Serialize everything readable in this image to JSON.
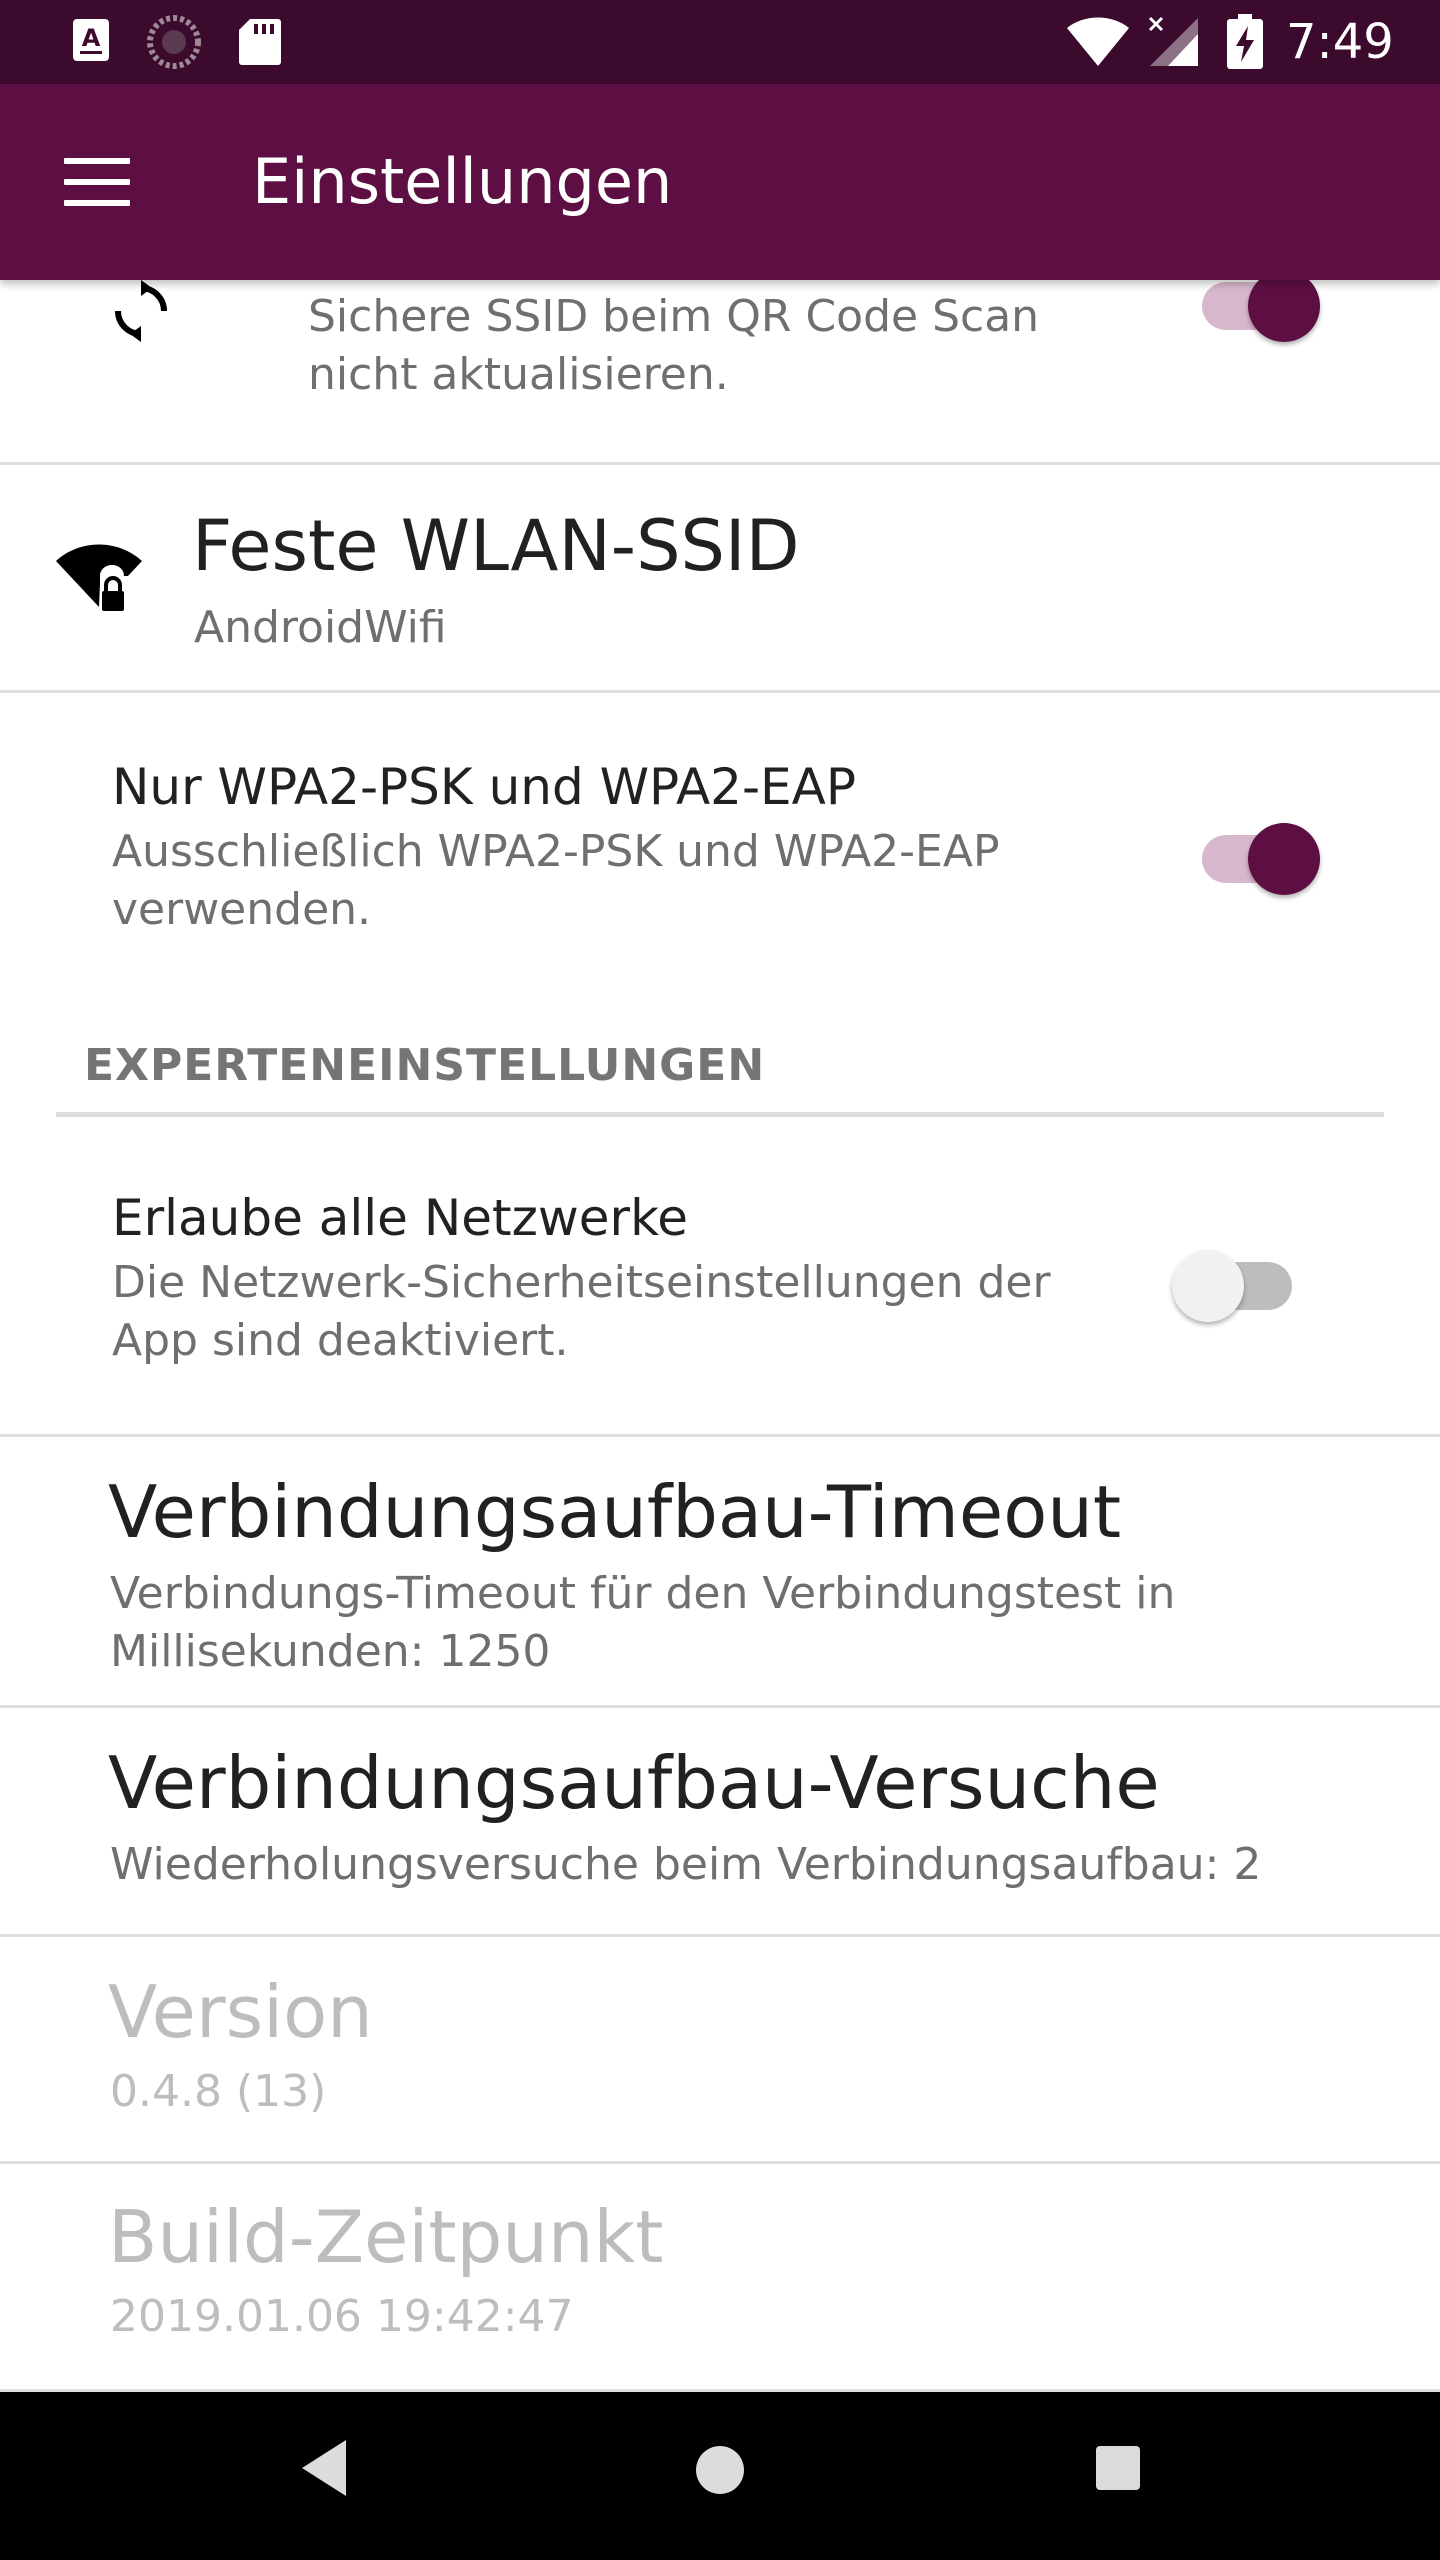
{
  "status_bar": {
    "time": "7:49",
    "icons": [
      "accessibility-a-icon",
      "sync-progress-icon",
      "sd-card-icon",
      "wifi-icon",
      "signal-no-data-icon",
      "battery-charging-icon"
    ]
  },
  "app_bar": {
    "title": "Einstellungen",
    "menu_icon": "hamburger-menu-icon"
  },
  "prefs": {
    "ssid_fixed_update": {
      "summary": "Sichere SSID beim QR Code Scan nicht aktualisieren.",
      "icon": "sync-icon",
      "enabled": true
    },
    "fixed_ssid": {
      "title": "Feste WLAN-SSID",
      "summary": "AndroidWifi",
      "icon": "wifi-lock-icon"
    },
    "wpa2_only": {
      "title": "Nur WPA2-PSK und WPA2-EAP",
      "summary": "Ausschließlich WPA2-PSK und WPA2-EAP verwenden.",
      "enabled": true
    },
    "expert_header": "EXPERTENEINSTELLUNGEN",
    "allow_all_networks": {
      "title": "Erlaube alle Netzwerke",
      "summary": "Die Netzwerk-Sicherheitseinstellungen der App sind deaktiviert.",
      "enabled": false
    },
    "connect_timeout": {
      "title": "Verbindungsaufbau-Timeout",
      "summary": "Verbindungs-Timeout für den Verbindungstest in Millisekunden: 1250"
    },
    "connect_retries": {
      "title": "Verbindungsaufbau-Versuche",
      "summary": "Wiederholungsversuche beim Verbindungsaufbau: 2"
    },
    "version": {
      "title": "Version",
      "summary": "0.4.8 (13)"
    },
    "build_time": {
      "title": "Build-Zeitpunkt",
      "summary": "2019.01.06 19:42:47"
    }
  },
  "nav_bar": {
    "back": "back-icon",
    "home": "home-icon",
    "recents": "recents-icon"
  },
  "colors": {
    "status_bar": "#3b0a2d",
    "app_bar": "#5d0f43",
    "accent": "#5d0f43",
    "switch_track_on": "#d7b7cc"
  }
}
